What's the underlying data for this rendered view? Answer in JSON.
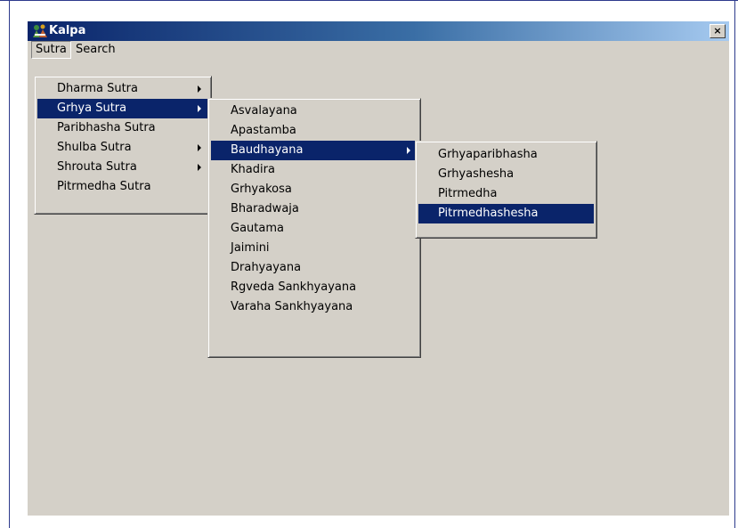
{
  "window": {
    "title": "Kalpa",
    "close_glyph": "×",
    "colors": {
      "titlebar_start": "#0a246a",
      "titlebar_end": "#a6caf0",
      "highlight": "#0a246a",
      "face": "#d4d0c8"
    }
  },
  "menubar": {
    "items": [
      "Sutra",
      "Search"
    ],
    "open": "Sutra"
  },
  "menu1": {
    "items": [
      {
        "label": "Dharma Sutra",
        "submenu": true
      },
      {
        "label": "Grhya Sutra",
        "submenu": true,
        "highlighted": true
      },
      {
        "label": "Paribhasha Sutra",
        "submenu": false
      },
      {
        "label": "Shulba Sutra",
        "submenu": true
      },
      {
        "label": "Shrouta Sutra",
        "submenu": true
      },
      {
        "label": "Pitrmedha Sutra",
        "submenu": false
      }
    ]
  },
  "menu2": {
    "items": [
      {
        "label": "Asvalayana"
      },
      {
        "label": "Apastamba"
      },
      {
        "label": "Baudhayana",
        "submenu": true,
        "highlighted": true
      },
      {
        "label": "Khadira"
      },
      {
        "label": "Grhyakosa"
      },
      {
        "label": "Bharadwaja"
      },
      {
        "label": "Gautama"
      },
      {
        "label": "Jaimini"
      },
      {
        "label": "Drahyayana"
      },
      {
        "label": "Rgveda Sankhyayana"
      },
      {
        "label": "Varaha Sankhyayana"
      }
    ]
  },
  "menu3": {
    "items": [
      {
        "label": "Grhyaparibhasha"
      },
      {
        "label": "Grhyashesha"
      },
      {
        "label": "Pitrmedha"
      },
      {
        "label": "Pitrmedhashesha",
        "highlighted": true
      }
    ]
  }
}
